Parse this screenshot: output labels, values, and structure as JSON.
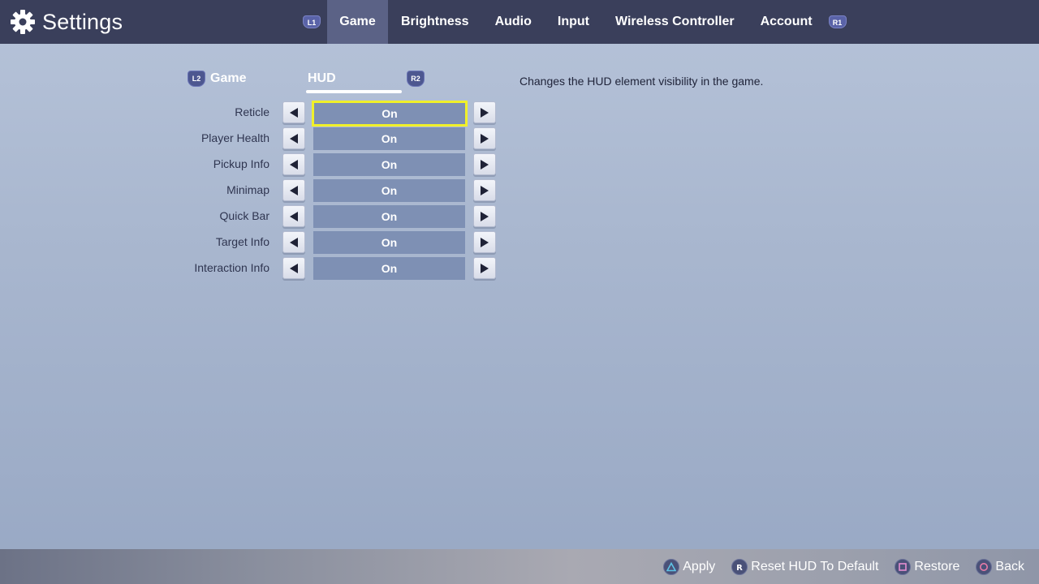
{
  "header": {
    "title": "Settings",
    "left_shoulder": "L1",
    "right_shoulder": "R1",
    "tabs": [
      {
        "label": "Game",
        "active": true
      },
      {
        "label": "Brightness",
        "active": false
      },
      {
        "label": "Audio",
        "active": false
      },
      {
        "label": "Input",
        "active": false
      },
      {
        "label": "Wireless Controller",
        "active": false
      },
      {
        "label": "Account",
        "active": false
      }
    ]
  },
  "subtabs": {
    "left_shoulder": "L2",
    "right_shoulder": "R2",
    "items": [
      {
        "label": "Game",
        "active": false
      },
      {
        "label": "HUD",
        "active": true
      }
    ]
  },
  "settings": [
    {
      "label": "Reticle",
      "value": "On",
      "focused": true
    },
    {
      "label": "Player Health",
      "value": "On",
      "focused": false
    },
    {
      "label": "Pickup Info",
      "value": "On",
      "focused": false
    },
    {
      "label": "Minimap",
      "value": "On",
      "focused": false
    },
    {
      "label": "Quick Bar",
      "value": "On",
      "focused": false
    },
    {
      "label": "Target Info",
      "value": "On",
      "focused": false
    },
    {
      "label": "Interaction Info",
      "value": "On",
      "focused": false
    }
  ],
  "description": "Changes the HUD element visibility in the game.",
  "footer": {
    "actions": [
      {
        "label": "Apply",
        "icon": "triangle-button-icon",
        "color": "#5ec3e6"
      },
      {
        "label": "Reset HUD To Default",
        "icon": "r3-button-icon",
        "color": "#ffffff"
      },
      {
        "label": "Restore",
        "icon": "square-button-icon",
        "color": "#e58fd1"
      },
      {
        "label": "Back",
        "icon": "circle-button-icon",
        "color": "#e87ba8"
      }
    ]
  },
  "colors": {
    "topbar": "#3a3f5b",
    "active_tab": "#5b6286",
    "value_box": "#7e90b4",
    "focus_outline": "#f0f02a"
  }
}
